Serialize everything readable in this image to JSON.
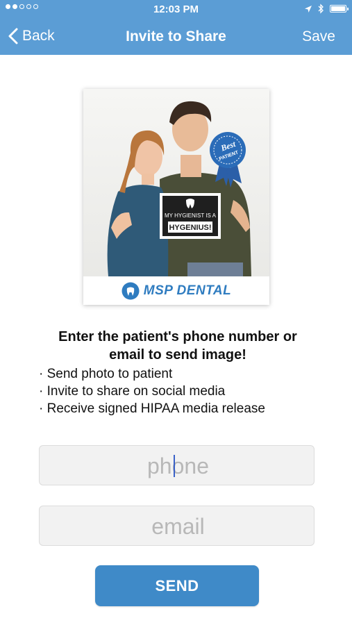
{
  "status_bar": {
    "time": "12:03 PM",
    "signal_dots": [
      true,
      true,
      false,
      false,
      false
    ]
  },
  "nav": {
    "back_label": "Back",
    "title": "Invite to Share",
    "save_label": "Save"
  },
  "photo": {
    "sign_line1": "MY HYGIENIST IS A",
    "sign_line2": "HYGENIUS!",
    "badge_line1": "Best",
    "badge_line2": "PATIENT",
    "logo_text": "MSP DENTAL"
  },
  "instructions": {
    "heading_line1": "Enter the patient's phone number or",
    "heading_line2": "email to send image!",
    "bullets": [
      "· Send photo to patient",
      "· Invite to share on social media",
      "· Receive signed HIPAA media release"
    ]
  },
  "form": {
    "phone_placeholder": "phone",
    "phone_value": "",
    "email_placeholder": "email",
    "email_value": "",
    "send_label": "SEND"
  },
  "colors": {
    "nav_background": "#5b9dd5",
    "button_background": "#3f8ac8",
    "logo_blue": "#2f7cc0"
  }
}
